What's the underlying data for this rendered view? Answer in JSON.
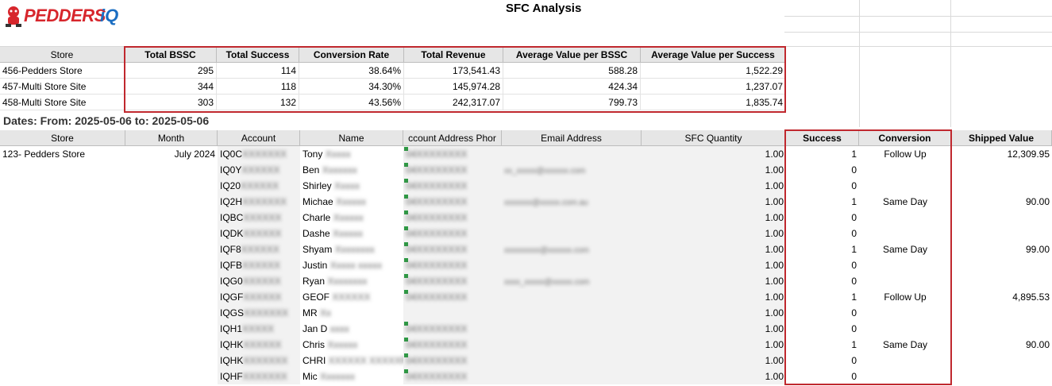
{
  "logo": {
    "text": "PEDDERS",
    "suffix": "iQ"
  },
  "report_title": "SFC Analysis",
  "summary": {
    "headers": [
      "Store",
      "Total BSSC",
      "Total Success",
      "Conversion Rate",
      "Total Revenue",
      "Average Value per BSSC",
      "Average Value per Success"
    ],
    "rows": [
      [
        "456-Pedders Store",
        "295",
        "114",
        "38.64%",
        "173,541.43",
        "588.28",
        "1,522.29"
      ],
      [
        "457-Multi Store Site",
        "344",
        "118",
        "34.30%",
        "145,974.28",
        "424.34",
        "1,237.07"
      ],
      [
        "458-Multi Store Site",
        "303",
        "132",
        "43.56%",
        "242,317.07",
        "799.73",
        "1,835.74"
      ]
    ]
  },
  "dates_label": "Dates: From: 2025-05-06 to: 2025-05-06",
  "detail": {
    "headers": [
      "Store",
      "Month",
      "Account",
      "Name",
      "ccount Address Phor",
      "Email Address",
      "SFC Quantity",
      "Success",
      "Conversion",
      "Shipped Value"
    ],
    "store": "123- Pedders Store",
    "month": "July 2024",
    "rows": [
      {
        "account": "IQ0C",
        "account_blur": "XXXXXXX",
        "name": "Tony",
        "name_blur": "Xxxxx",
        "phone": "04XXXXXXXX",
        "email": "",
        "qty": "1.00",
        "success": "1",
        "conversion": "Follow Up",
        "shipped": "12,309.95"
      },
      {
        "account": "IQ0Y",
        "account_blur": "XXXXXX",
        "name": "Ben",
        "name_blur": "Xxxxxxx",
        "phone": "04XXXXXXXX",
        "email": "xx_xxxxx@xxxxxx.com",
        "qty": "1.00",
        "success": "0",
        "conversion": "",
        "shipped": ""
      },
      {
        "account": "IQ20",
        "account_blur": "XXXXXX",
        "name": "Shirley",
        "name_blur": "Xxxxx",
        "phone": "04XXXXXXXX",
        "email": "",
        "qty": "1.00",
        "success": "0",
        "conversion": "",
        "shipped": ""
      },
      {
        "account": "IQ2H",
        "account_blur": "XXXXXXX",
        "name": "Michae",
        "name_blur": "Xxxxxx",
        "phone": "04XXXXXXXX",
        "email": "xxxxxxx@xxxxx.com.au",
        "qty": "1.00",
        "success": "1",
        "conversion": "Same Day",
        "shipped": "90.00"
      },
      {
        "account": "IQBC",
        "account_blur": "XXXXXX",
        "name": "Charle",
        "name_blur": "Xxxxxx",
        "phone": "04XXXXXXXX",
        "email": "",
        "qty": "1.00",
        "success": "0",
        "conversion": "",
        "shipped": ""
      },
      {
        "account": "IQDK",
        "account_blur": "XXXXXX",
        "name": "Dashe",
        "name_blur": "Xxxxxx",
        "phone": "04XXXXXXXX",
        "email": "",
        "qty": "1.00",
        "success": "0",
        "conversion": "",
        "shipped": ""
      },
      {
        "account": "IQF8",
        "account_blur": "XXXXXX",
        "name": "Shyam",
        "name_blur": "Xxxxxxxx",
        "phone": "04XXXXXXXX",
        "email": "xxxxxxxxx@xxxxxx.com",
        "qty": "1.00",
        "success": "1",
        "conversion": "Same Day",
        "shipped": "99.00"
      },
      {
        "account": "IQFB",
        "account_blur": "XXXXXX",
        "name": "Justin",
        "name_blur": "Xxxxx xxxxx",
        "phone": "04XXXXXXXX",
        "email": "",
        "qty": "1.00",
        "success": "0",
        "conversion": "",
        "shipped": ""
      },
      {
        "account": "IQG0",
        "account_blur": "XXXXXX",
        "name": "Ryan",
        "name_blur": "Xxxxxxxx",
        "phone": "04XXXXXXXX",
        "email": "xxxx_xxxxx@xxxxx.com",
        "qty": "1.00",
        "success": "0",
        "conversion": "",
        "shipped": ""
      },
      {
        "account": "IQGF",
        "account_blur": "XXXXXX",
        "name": "GEOF",
        "name_blur": "XXXXXX",
        "phone": "04XXXXXXXX",
        "email": "",
        "qty": "1.00",
        "success": "1",
        "conversion": "Follow Up",
        "shipped": "4,895.53"
      },
      {
        "account": "IQGS",
        "account_blur": "XXXXXXX",
        "name": "MR",
        "name_blur": "Xx",
        "phone": "",
        "email": "",
        "qty": "1.00",
        "success": "0",
        "conversion": "",
        "shipped": ""
      },
      {
        "account": "IQH1",
        "account_blur": "XXXXX",
        "name": "Jan D",
        "name_blur": "xxxx",
        "phone": "04XXXXXXXX",
        "email": "",
        "qty": "1.00",
        "success": "0",
        "conversion": "",
        "shipped": ""
      },
      {
        "account": "IQHK",
        "account_blur": "XXXXXX",
        "name": "Chris",
        "name_blur": "Xxxxxx",
        "phone": "04XXXXXXXX",
        "email": "",
        "qty": "1.00",
        "success": "1",
        "conversion": "Same Day",
        "shipped": "90.00"
      },
      {
        "account": "IQHK",
        "account_blur": "XXXXXXX",
        "name": "CHRI",
        "name_blur": "XXXXXX XXXXXR",
        "phone": "04XXXXXXXX",
        "email": "",
        "qty": "1.00",
        "success": "0",
        "conversion": "",
        "shipped": ""
      },
      {
        "account": "IQHF",
        "account_blur": "XXXXXXX",
        "name": "Mic",
        "name_blur": "Xxxxxxx",
        "phone": "04XXXXXXXX",
        "email": "",
        "qty": "1.00",
        "success": "0",
        "conversion": "",
        "shipped": ""
      }
    ]
  },
  "colors": {
    "highlight_border": "#c0282e",
    "header_bg": "#e6e6e6",
    "logo_red": "#d7262c",
    "logo_blue": "#1b6ec2",
    "phone_flag": "#2e9a44"
  }
}
